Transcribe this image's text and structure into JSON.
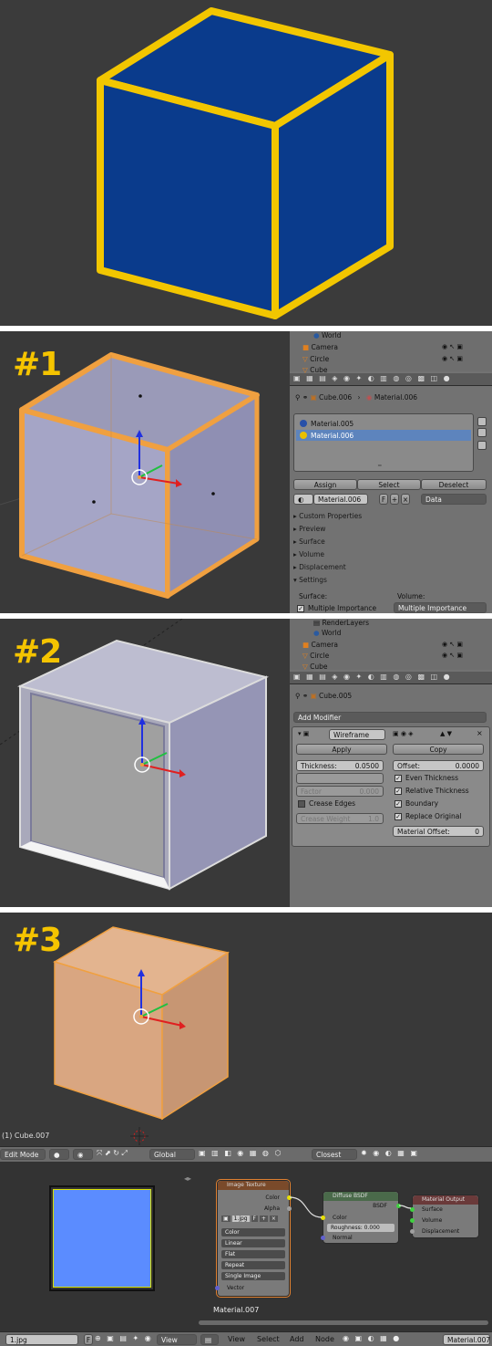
{
  "panel2": {
    "label": "#1",
    "outliner": [
      "World",
      "Camera",
      "Circle",
      "Cube"
    ],
    "breadcrumb": [
      "Cube.006",
      "Material.006"
    ],
    "material_slots": [
      "Material.005",
      "Material.006"
    ],
    "buttons": {
      "assign": "Assign",
      "select": "Select",
      "deselect": "Deselect"
    },
    "material_field": "Material.006",
    "fake_user": "F",
    "link_mode": "Data",
    "sections": [
      "Custom Properties",
      "Preview",
      "Surface",
      "Volume",
      "Displacement",
      "Settings"
    ],
    "settings": {
      "surface_label": "Surface:",
      "volume_label": "Volume:",
      "surface_value": "Multiple Importance",
      "volume_value": "Multiple Importance"
    },
    "colors": {
      "slot5": "#2850a8",
      "slot6": "#e8c000",
      "selected": "#5d84bd"
    }
  },
  "panel3": {
    "label": "#2",
    "outliner": [
      "RenderLayers",
      "World",
      "Camera",
      "Circle",
      "Cube"
    ],
    "breadcrumb": [
      "Cube.005"
    ],
    "add_modifier": "Add Modifier",
    "modifier_name": "Wireframe",
    "apply": "Apply",
    "copy": "Copy",
    "thickness_label": "Thickness:",
    "thickness_value": "0.0500",
    "offset_label": "Offset:",
    "offset_value": "0.0000",
    "factor_label": "Factor",
    "factor_value": "0.000",
    "crease_edges": "Crease Edges",
    "crease_weight_label": "Crease Weight",
    "crease_weight_value": "1.0",
    "even_thickness": "Even Thickness",
    "relative_thickness": "Relative Thickness",
    "boundary": "Boundary",
    "replace_original": "Replace Original",
    "material_offset_label": "Material Offset:",
    "material_offset_value": "0"
  },
  "panel4": {
    "label": "#3",
    "object_label": "(1) Cube.007",
    "header": {
      "mode": "Edit Mode",
      "orientation": "Global",
      "snap": "Closest"
    },
    "node_image": {
      "title": "Image Texture",
      "out_color": "Color",
      "out_alpha": "Alpha",
      "image": "1.jpg",
      "color": "Color",
      "interp": "Linear",
      "proj": "Flat",
      "ext": "Repeat",
      "source": "Single Image",
      "in_vector": "Vector"
    },
    "node_bsdf": {
      "title": "Diffuse BSDF",
      "out": "BSDF",
      "in_color": "Color",
      "roughness": "Roughness: 0.000",
      "in_normal": "Normal"
    },
    "node_output": {
      "title": "Material Output",
      "surface": "Surface",
      "volume": "Volume",
      "displacement": "Displacement"
    },
    "material_label": "Material.007",
    "bottom": {
      "image": "1.jpg",
      "fake": "F",
      "view": "View",
      "menus": [
        "View",
        "Select",
        "Add",
        "Node"
      ],
      "material": "Material.007"
    },
    "preview_color": "#5b8cff"
  }
}
